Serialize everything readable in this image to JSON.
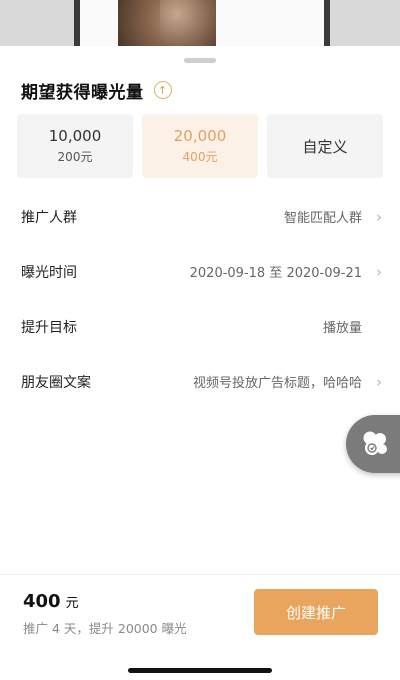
{
  "sheet": {
    "title": "期望获得曝光量"
  },
  "options": [
    {
      "amount": "10,000",
      "price": "200元",
      "selected": false
    },
    {
      "amount": "20,000",
      "price": "400元",
      "selected": true
    },
    {
      "label": "自定义",
      "selected": false
    }
  ],
  "rows": [
    {
      "label": "推广人群",
      "value": "智能匹配人群",
      "chevron": true
    },
    {
      "label": "曝光时间",
      "value": "2020-09-18 至 2020-09-21",
      "chevron": true
    },
    {
      "label": "提升目标",
      "value": "播放量",
      "chevron": false
    },
    {
      "label": "朋友圈文案",
      "value": "视频号投放广告标题，哈哈哈",
      "chevron": true
    }
  ],
  "footer": {
    "total_amount": "400",
    "total_unit": "元",
    "summary": "推广 4 天，提升 20000 曝光",
    "create_label": "创建推广"
  },
  "colors": {
    "accent": "#e9a45d",
    "selected_bg": "#fbf1e6",
    "selected_text": "#e2a162",
    "option_bg": "#f4f4f4"
  },
  "icons": {
    "title_badge": "arrow-up-circle-icon",
    "row_chevron": "chevron-right-icon",
    "float": "assistant-bubble-icon"
  }
}
